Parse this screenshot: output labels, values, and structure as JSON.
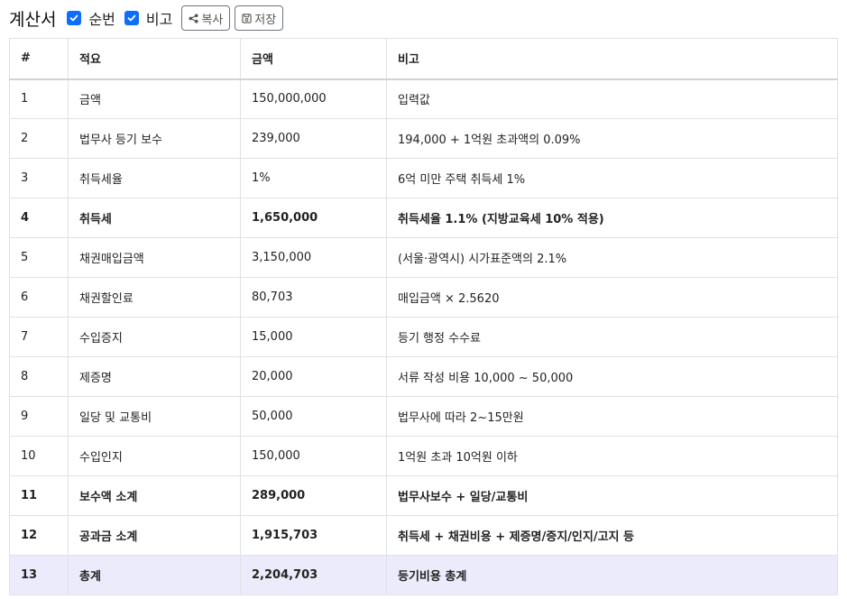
{
  "header": {
    "title": "계산서",
    "checkbox_order": "순번",
    "checkbox_note": "비고",
    "copy_button": "복사",
    "save_button": "저장"
  },
  "table": {
    "columns": [
      "#",
      "적요",
      "금액",
      "비고"
    ],
    "rows": [
      {
        "no": "1",
        "item": "금액",
        "amount": "150,000,000",
        "note": "입력값",
        "style": ""
      },
      {
        "no": "2",
        "item": "법무사 등기 보수",
        "amount": "239,000",
        "note": "194,000 + 1억원 초과액의 0.09%",
        "style": ""
      },
      {
        "no": "3",
        "item": "취득세율",
        "amount": "1%",
        "note": "6억 미만 주택 취득세 1%",
        "style": ""
      },
      {
        "no": "4",
        "item": "취득세",
        "amount": "1,650,000",
        "note": "취득세율 1.1% (지방교육세 10% 적용)",
        "style": "bold"
      },
      {
        "no": "5",
        "item": "채권매입금액",
        "amount": "3,150,000",
        "note": "(서울·광역시) 시가표준액의 2.1%",
        "style": ""
      },
      {
        "no": "6",
        "item": "채권할인료",
        "amount": "80,703",
        "note": "매입금액 × 2.5620",
        "style": ""
      },
      {
        "no": "7",
        "item": "수입증지",
        "amount": "15,000",
        "note": "등기 행정 수수료",
        "style": ""
      },
      {
        "no": "8",
        "item": "제증명",
        "amount": "20,000",
        "note": "서류 작성 비용 10,000 ~ 50,000",
        "style": ""
      },
      {
        "no": "9",
        "item": "일당 및 교통비",
        "amount": "50,000",
        "note": "법무사에 따라 2~15만원",
        "style": ""
      },
      {
        "no": "10",
        "item": "수입인지",
        "amount": "150,000",
        "note": "1억원 초과 10억원 이하",
        "style": ""
      },
      {
        "no": "11",
        "item": "보수액 소계",
        "amount": "289,000",
        "note": "법무사보수 + 일당/교통비",
        "style": "bold"
      },
      {
        "no": "12",
        "item": "공과금 소계",
        "amount": "1,915,703",
        "note": "취득세 + 채권비용 + 제증명/증지/인지/고지 등",
        "style": "bold"
      },
      {
        "no": "13",
        "item": "총계",
        "amount": "2,204,703",
        "note": "등기비용 총계",
        "style": "total"
      }
    ]
  },
  "colors": {
    "checkbox": "#0d6efd",
    "total_row_bg": "#ebebfb",
    "border": "#dee2e6"
  }
}
